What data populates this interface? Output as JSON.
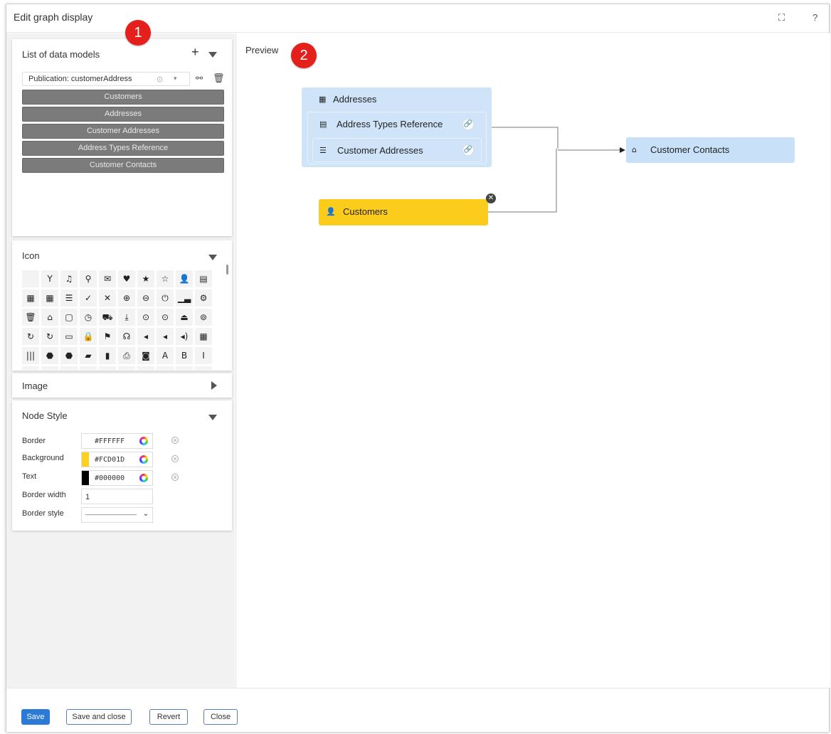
{
  "dialog": {
    "title": "Edit graph display"
  },
  "header_icons": {
    "expand": "expand-icon",
    "help": "?"
  },
  "data_models": {
    "title": "List of data models",
    "add_glyph": "+",
    "selected_publication": "Publication: customerAddress",
    "items": [
      "Customers",
      "Addresses",
      "Customer Addresses",
      "Address Types Reference",
      "Customer Contacts"
    ]
  },
  "icon_panel": {
    "title": "Icon",
    "rows": [
      [
        "",
        "Y",
        "♫",
        "⚲",
        "✉",
        "♥",
        "★",
        "☆",
        "👤",
        "▤"
      ],
      [
        "▦",
        "▦",
        "☰",
        "✓",
        "✕",
        "⊕",
        "⊖",
        "⏻",
        "▁▃",
        "⚙"
      ],
      [
        "🗑",
        "⌂",
        "▢",
        "◷",
        "⛟",
        "⤓",
        "⊙",
        "⊙",
        "⏏",
        "⊚"
      ],
      [
        "↻",
        "↻",
        "▭",
        "🔒",
        "⚑",
        "☊",
        "◂",
        "◂",
        "◂)",
        "▦"
      ],
      [
        "|||",
        "⬣",
        "⬣",
        "▰",
        "▮",
        "⎙",
        "◙",
        "A",
        "B",
        "I"
      ]
    ]
  },
  "image_panel": {
    "title": "Image"
  },
  "node_style": {
    "title": "Node Style",
    "border_label": "Border",
    "border_value": "#FFFFFF",
    "border_color": "#FFFFFF",
    "background_label": "Background",
    "background_value": "#FCD01D",
    "background_color": "#FCD01D",
    "text_label": "Text",
    "text_value": "#000000",
    "text_color": "#000000",
    "border_width_label": "Border width",
    "border_width_value": "1",
    "border_style_label": "Border style",
    "border_style_value": "————————"
  },
  "preview": {
    "title": "Preview",
    "group_label": "Addresses",
    "group_children": [
      "Address Types Reference",
      "Customer Addresses"
    ],
    "target_node": "Customer Contacts",
    "source_node": "Customers",
    "colors": {
      "group_bg": "#cfe4f8",
      "target_bg": "#c8e1f8",
      "source_bg": "#fccc1d"
    }
  },
  "callouts": [
    "1",
    "2"
  ],
  "footer": {
    "save": "Save",
    "save_close": "Save and close",
    "revert": "Revert",
    "close": "Close"
  }
}
